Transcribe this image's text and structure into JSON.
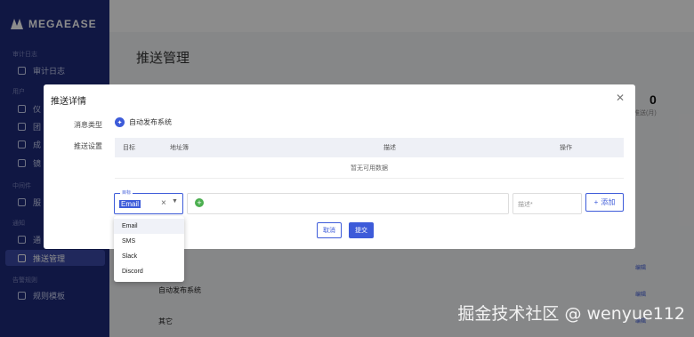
{
  "app": {
    "brand": "MEGAEASE"
  },
  "sidebar": {
    "groups": [
      {
        "label": "审计日志"
      },
      {
        "label": "用户"
      },
      {
        "label": "中间件"
      },
      {
        "label": "通知"
      },
      {
        "label": "告警规则"
      }
    ],
    "items": [
      {
        "label": "审计日志"
      },
      {
        "label": "仪"
      },
      {
        "label": "团"
      },
      {
        "label": "成"
      },
      {
        "label": "镜"
      },
      {
        "label": "服"
      },
      {
        "label": "通"
      },
      {
        "label": "推送管理"
      },
      {
        "label": "规则模板"
      }
    ]
  },
  "page": {
    "title": "推送管理",
    "stat_value": "0",
    "stat_label": "推送(月)"
  },
  "modal": {
    "title": "推送详情",
    "message_type_label": "消息类型",
    "message_type_value": "自动发布系统",
    "push_settings_label": "推送设置",
    "table": {
      "headers": [
        "目标",
        "地址簿",
        "描述",
        "操作"
      ],
      "empty_text": "暂无可用数据"
    },
    "select": {
      "label": "目标",
      "value": "Email"
    },
    "description_placeholder": "描述*",
    "add_label": "添加",
    "cancel_label": "取消",
    "submit_label": "提交"
  },
  "dropdown": {
    "options": [
      "Email",
      "SMS",
      "Slack",
      "Discord"
    ]
  },
  "background": {
    "rows": [
      {
        "label": "自动发布系统"
      },
      {
        "label": "其它"
      }
    ],
    "link_label": "编辑"
  },
  "watermark": "掘金技术社区 @ wenyue112",
  "colors": {
    "sidebar": "#1e2a7a",
    "accent": "#3d5bd9",
    "success": "#4caf50"
  }
}
